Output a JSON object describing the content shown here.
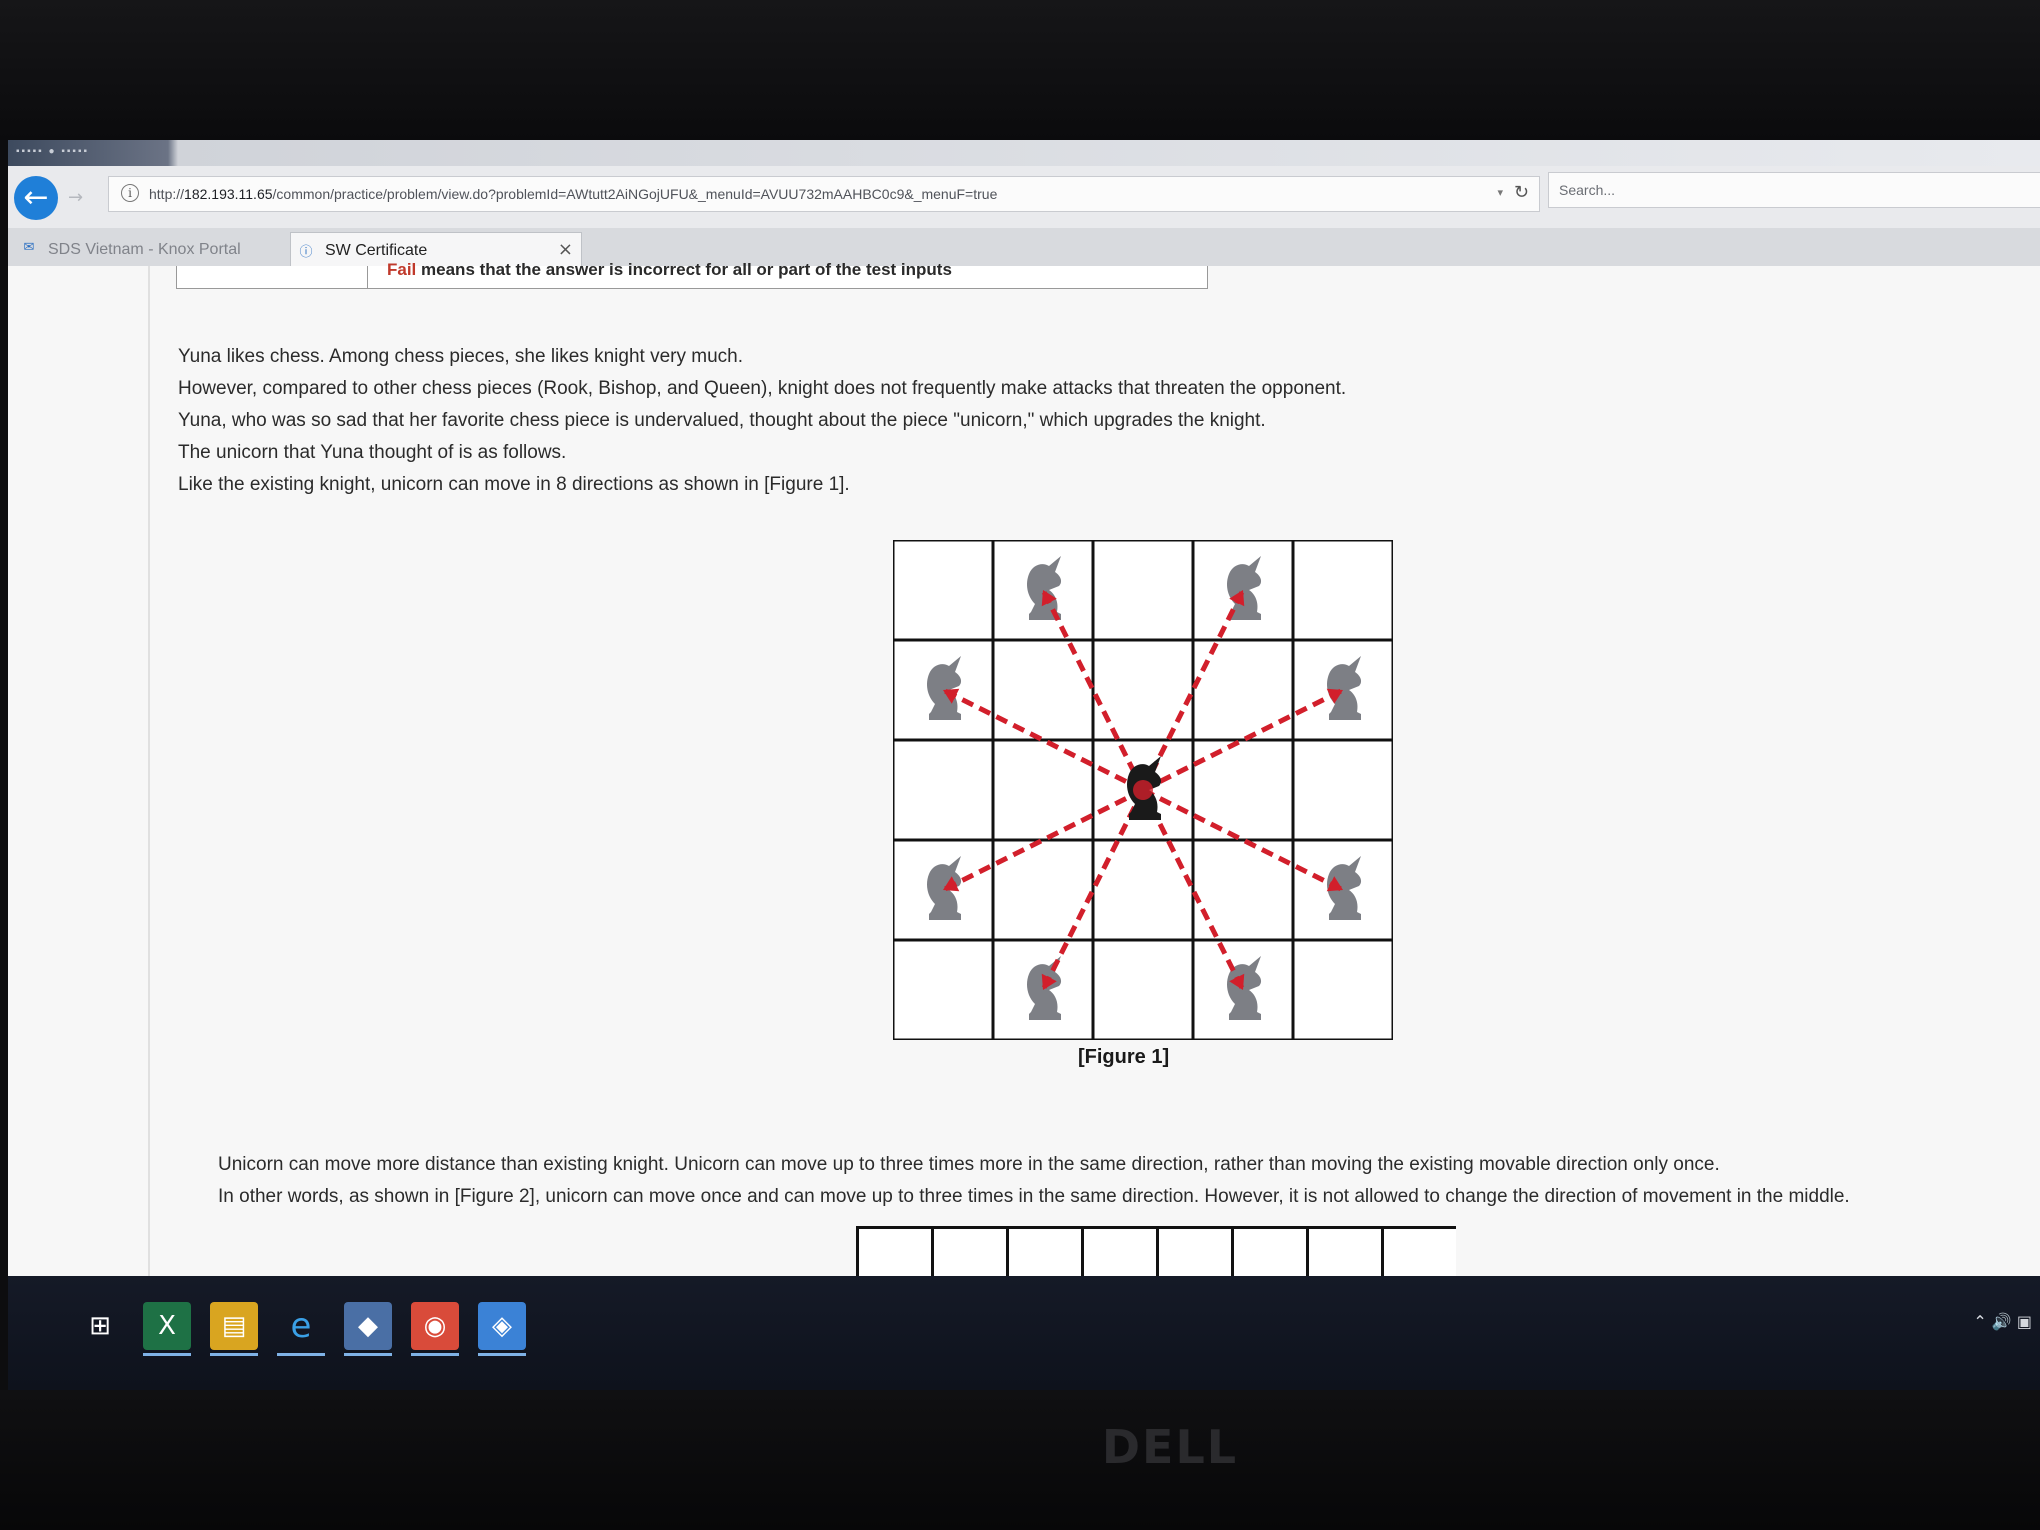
{
  "browser": {
    "url_prefix": "http://",
    "url_host": "182.193.11.65",
    "url_path": "/common/practice/problem/view.do?problemId=AWtutt2AiNGojUFU&_menuId=AVUU732mAAHBC0c9&_menuF=true",
    "search_placeholder": "Search...",
    "tabs": [
      {
        "label": "SDS Vietnam - Knox Portal"
      },
      {
        "label": "SW Certificate"
      }
    ]
  },
  "page": {
    "result_line": "means that the answer is incorrect for all or part of the test inputs",
    "paragraphs": [
      "Yuna likes chess. Among chess pieces, she likes knight very much.",
      "However, compared to other chess pieces (Rook, Bishop, and Queen), knight does not frequently make attacks that threaten the opponent.",
      "Yuna, who was so sad that her favorite chess piece is undervalued, thought about the piece \"unicorn,\" which upgrades the knight.",
      "The unicorn that Yuna thought of is as follows.",
      "Like the existing knight, unicorn can move in 8 directions as shown in [Figure 1]."
    ],
    "figure1_caption": "[Figure 1]",
    "paragraphs2": [
      "Unicorn can move more distance than existing knight. Unicorn can move up to three times more in the same direction, rather than moving the existing movable direction only once.",
      "In other words, as shown in [Figure 2], unicorn can move once and can move up to three times in the same direction. However, it is not allowed to change the direction of movement in the middle."
    ]
  },
  "board": {
    "size": 5,
    "center": [
      2,
      2
    ],
    "targets": [
      [
        0,
        1
      ],
      [
        0,
        3
      ],
      [
        1,
        0
      ],
      [
        1,
        4
      ],
      [
        3,
        0
      ],
      [
        3,
        4
      ],
      [
        4,
        1
      ],
      [
        4,
        3
      ]
    ],
    "arrow_color": "#d21f2b",
    "piece_color": "#7d7f85",
    "center_color": "#1a1a1a"
  },
  "figure2": {
    "columns": 8
  },
  "taskbar": {
    "items": [
      "start-icon",
      "excel-icon",
      "file-explorer-icon",
      "internet-explorer-icon",
      "app-icon",
      "chrome-icon",
      "app-launcher-icon"
    ]
  },
  "brand": "DELL"
}
